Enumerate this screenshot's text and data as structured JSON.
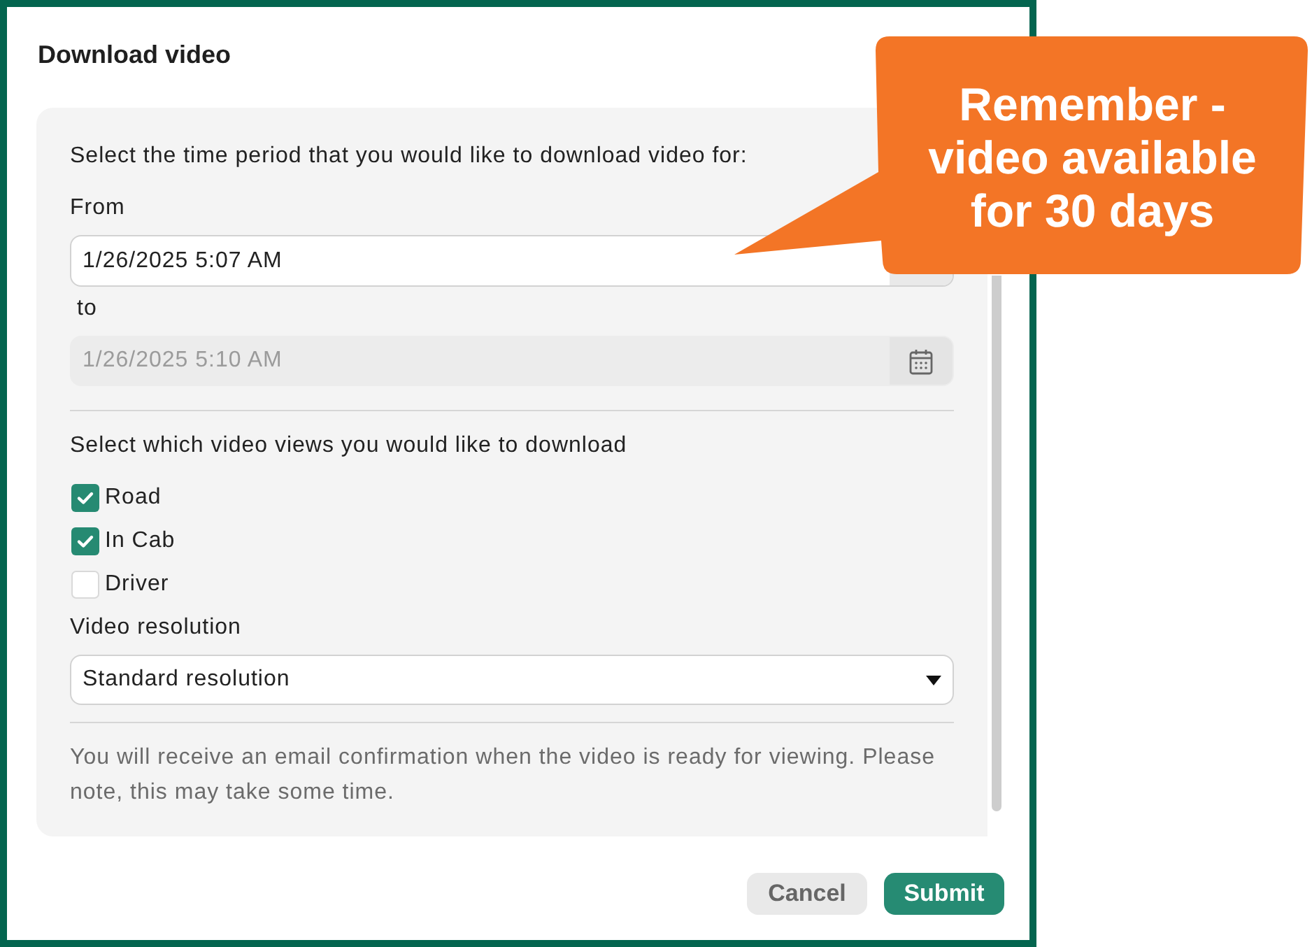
{
  "dialog": {
    "title": "Download video"
  },
  "time_period": {
    "prompt": "Select the time period that you would like to download video for:",
    "from": {
      "label": "From",
      "value": "1/26/2025 5:07 AM",
      "disabled": false
    },
    "to": {
      "label": "to",
      "value": "1/26/2025 5:10 AM",
      "disabled": true
    }
  },
  "views": {
    "prompt": "Select which video views you would like to download",
    "options": [
      {
        "label": "Road",
        "checked": true
      },
      {
        "label": "In Cab",
        "checked": true
      },
      {
        "label": "Driver",
        "checked": false
      }
    ]
  },
  "resolution": {
    "label": "Video resolution",
    "value": "Standard resolution"
  },
  "note": "You will receive an email confirmation when the video is ready for viewing. Please note, this may take some time.",
  "buttons": [
    {
      "label": "Cancel",
      "kind": "secondary"
    },
    {
      "label": "Submit",
      "kind": "primary"
    }
  ],
  "callout": {
    "lines": [
      "Remember -",
      "video available",
      "for 30 days"
    ]
  }
}
